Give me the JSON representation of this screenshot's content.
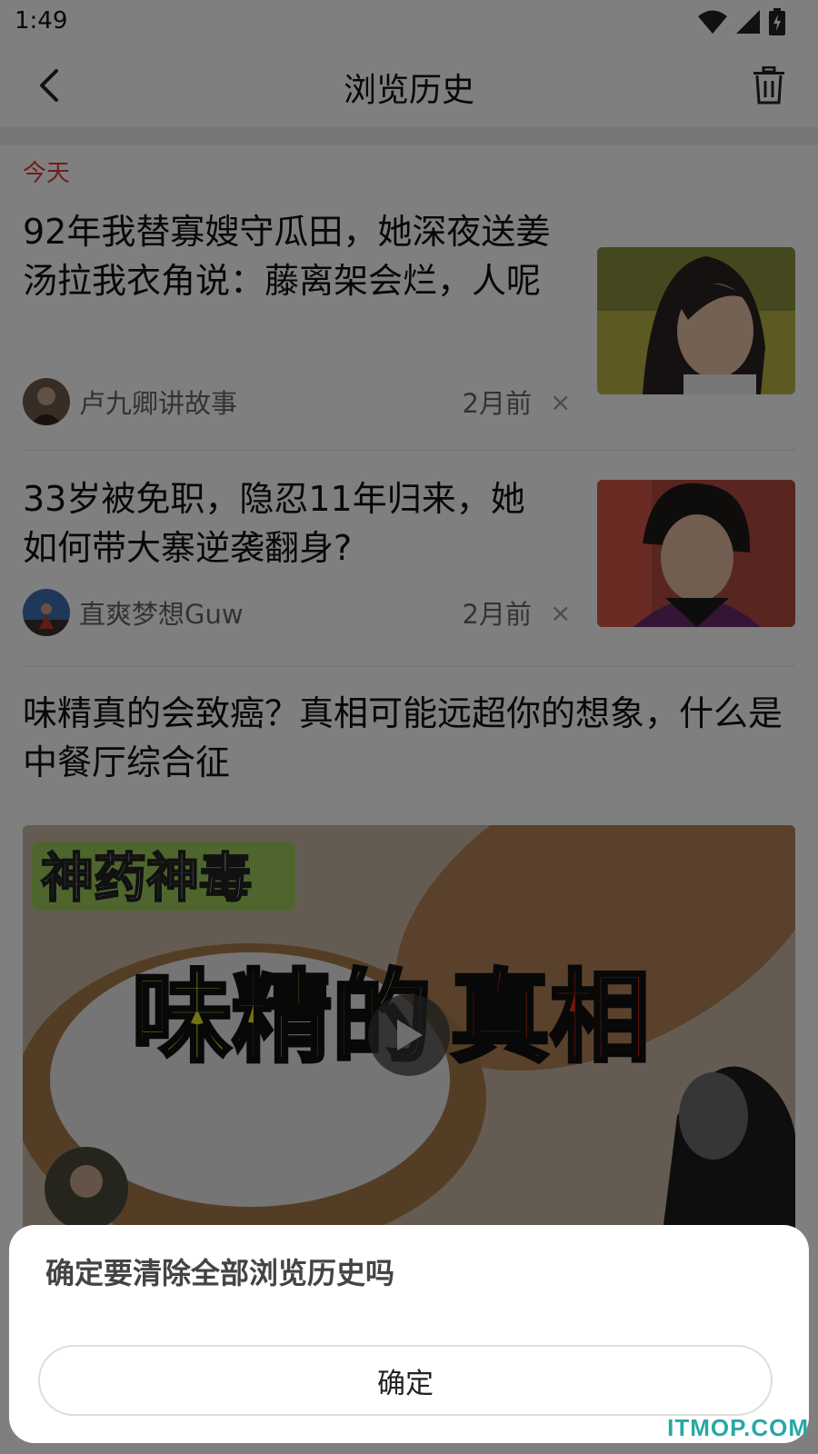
{
  "status_bar": {
    "time": "1:49",
    "icons": [
      "wifi-icon",
      "cell-signal-icon",
      "battery-charging-icon"
    ]
  },
  "header": {
    "title": "浏览历史",
    "back_icon": "chevron-left-icon",
    "delete_icon": "trash-icon"
  },
  "history": {
    "section_label": "今天",
    "section_label_color": "#e03a3a",
    "items": [
      {
        "title": "92年我替寡嫂守瓜田，她深夜送姜汤拉我衣角说：藤离架会烂，人呢",
        "author": "卢九卿讲故事",
        "time": "2月前",
        "remove": "×"
      },
      {
        "title": "33岁被免职，隐忍11年归来，她如何带大寨逆袭翻身?",
        "author": "直爽梦想Guw",
        "time": "2月前",
        "remove": "×"
      },
      {
        "title": "味精真的会致癌？真相可能远超你的想象，什么是中餐厅综合征",
        "video_tag": "神药神毒",
        "video_headline_a": "味精的",
        "video_headline_b": "真相"
      }
    ]
  },
  "dialog": {
    "message": "确定要清除全部浏览历史吗",
    "confirm_label": "确定"
  },
  "watermark": "ITMOP.COM"
}
